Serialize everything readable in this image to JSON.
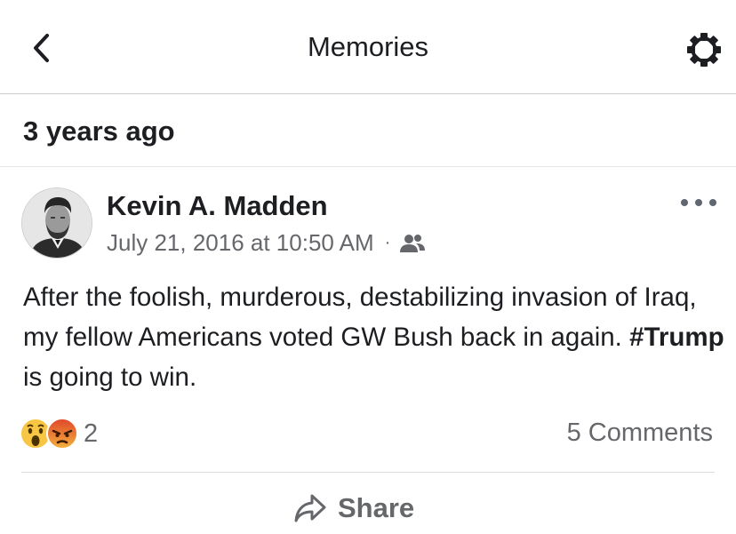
{
  "navbar": {
    "title": "Memories",
    "back_icon": "chevron-left-icon",
    "settings_icon": "gear-icon"
  },
  "section": {
    "label": "3 years ago"
  },
  "post": {
    "author": "Kevin A. Madden",
    "timestamp": "July 21, 2016 at 10:50 AM",
    "separator": "·",
    "audience_icon": "friends-icon",
    "text_before": "After the foolish, murderous, destabilizing invasion of Iraq, my fellow Americans voted GW Bush back in again. ",
    "hashtag": "#Trump",
    "text_after": " is going to win.",
    "reactions": {
      "icons": [
        "wow-reaction-icon",
        "angry-reaction-icon"
      ],
      "count": "2"
    },
    "comments": "5 Comments",
    "share_label": "Share",
    "colors": {
      "primary_text": "#1c1e21",
      "secondary_text": "#65676b",
      "divider": "#dadde1"
    }
  }
}
